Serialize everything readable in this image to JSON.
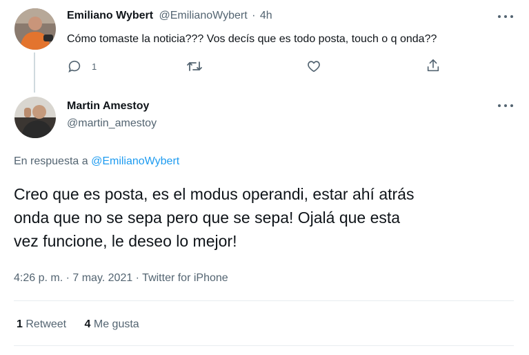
{
  "first_tweet": {
    "author_name": "Emiliano Wybert",
    "handle": "@EmilianoWybert",
    "separator": "·",
    "time": "4h",
    "text": "Cómo tomaste la noticia??? Vos decís que es todo posta, touch o q onda??",
    "reply_count": "1",
    "icons": [
      "reply-icon",
      "retweet-icon",
      "like-icon",
      "share-icon",
      "more-icon"
    ]
  },
  "main_tweet": {
    "author_name": "Martin Amestoy",
    "handle": "@martin_amestoy",
    "reply_prefix": "En respuesta a",
    "reply_to": "@EmilianoWybert",
    "text_lines": [
      "Creo que es posta, es el modus operandi, estar ahí atrás",
      "onda que no se sepa pero que se sepa! Ojalá que esta",
      "vez funcione, le deseo lo mejor!"
    ],
    "timestamp": "4:26 p. m. · 7 may. 2021 · ",
    "source": "Twitter for iPhone",
    "stats": {
      "retweets_count": "1",
      "retweets_label": "Retweet",
      "likes_count": "4",
      "likes_label": "Me gusta"
    }
  },
  "colors": {
    "text": "#0f1419",
    "muted": "#536471",
    "link": "#1d9bf0",
    "divider": "#e7ecf0"
  }
}
